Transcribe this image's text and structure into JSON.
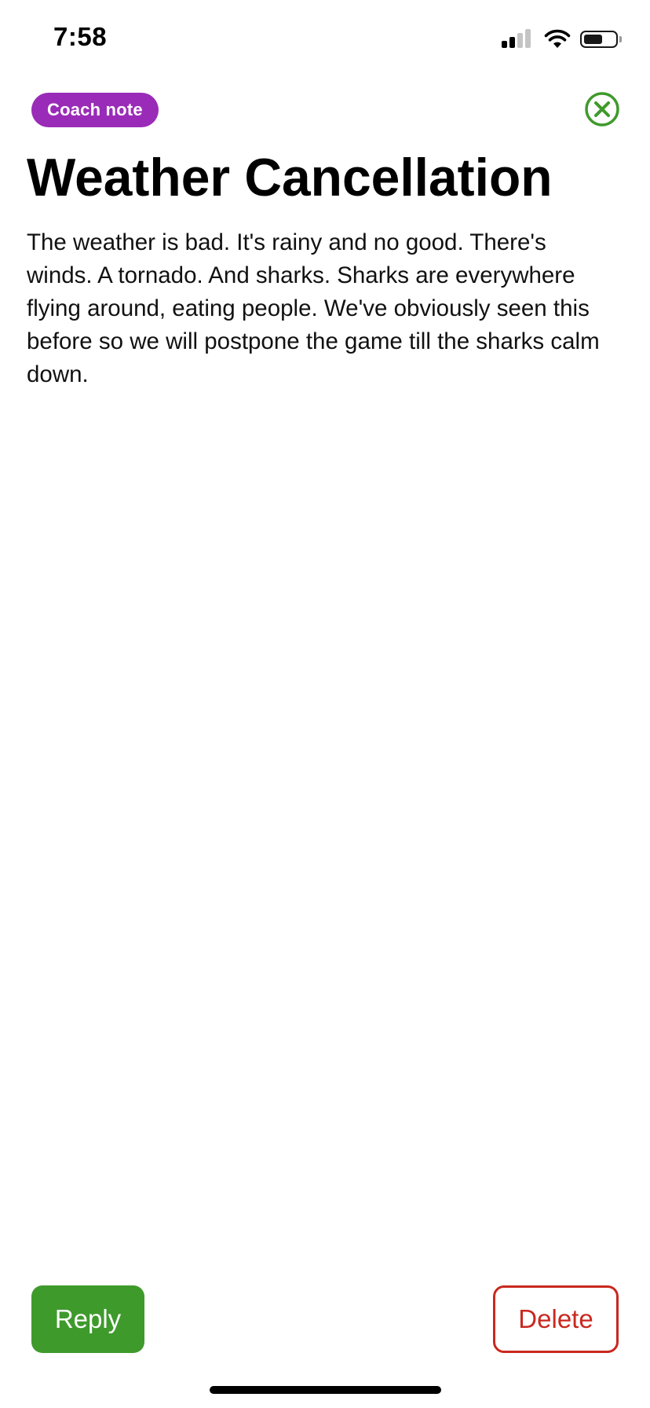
{
  "status_bar": {
    "time": "7:58",
    "signal_bars_active": 2,
    "signal_bars_total": 4,
    "battery_level": 0.6
  },
  "note": {
    "badge_label": "Coach note",
    "title": "Weather Cancellation",
    "body": "The weather is bad. It's rainy and no good. There's winds. A tornado. And sharks. Sharks are everywhere flying around, eating people. We've obviously seen this before so we will postpone the game till the sharks calm down."
  },
  "actions": {
    "reply_label": "Reply",
    "delete_label": "Delete"
  },
  "icons": {
    "close": "close-circle-icon",
    "signal": "cellular-signal-icon",
    "wifi": "wifi-icon",
    "battery": "battery-icon"
  },
  "colors": {
    "badge": "#9a2bb8",
    "accent_green": "#3f9a2c",
    "danger_red": "#c9281f"
  }
}
